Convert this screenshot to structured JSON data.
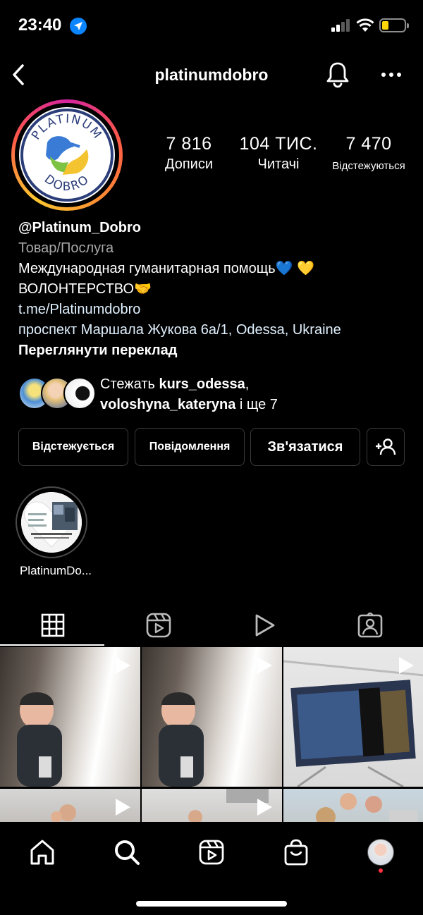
{
  "status_bar": {
    "time": "23:40"
  },
  "header": {
    "title": "platinumdobro"
  },
  "avatar": {
    "logo_text_top": "PLATINUM",
    "logo_text_bottom": "DOBRO"
  },
  "stats": [
    {
      "value": "7 816",
      "label": "Дописи"
    },
    {
      "value": "104 ТИС.",
      "label": "Читачі"
    },
    {
      "value": "7 470",
      "label": "Відстежуються"
    }
  ],
  "bio": {
    "name": "@Platinum_Dobro",
    "category": "Товар/Послуга",
    "line1": "Международная гуманитарная помощь💙 💛",
    "line2": "ВОЛОНТЕРСТВО🤝",
    "link": "t.me/Platinumdobro",
    "address": "проспект Маршала Жукова 6а/1, Odessa, Ukraine",
    "translate": "Переглянути переклад"
  },
  "followed_by": {
    "prefix": "Стежать ",
    "user1": "kurs_odessa",
    "sep": ",",
    "user2": "voloshyna_katerynа",
    "suffix": " і ще 7"
  },
  "actions": {
    "following": "Відстежується",
    "message": "Повідомлення",
    "contact": "Зв'язатися"
  },
  "highlights": [
    {
      "label": "PlatinumDo..."
    }
  ],
  "tabs": [
    "grid-icon",
    "reels-icon",
    "video-icon",
    "tagged-icon"
  ],
  "bottom_nav": [
    "home-icon",
    "search-icon",
    "reels-icon",
    "shop-icon",
    "profile-avatar"
  ],
  "colors": {
    "accent_blue": "#0a84ff",
    "battery": "#ffd60a",
    "notification_dot": "#ff3040"
  }
}
